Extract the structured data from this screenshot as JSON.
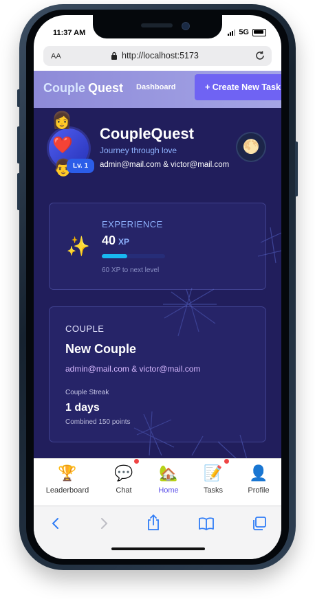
{
  "status": {
    "time": "11:37 AM",
    "network": "5G"
  },
  "browser": {
    "text_size": "AA",
    "url": "http://localhost:5173"
  },
  "header": {
    "brand_part1": "Couple",
    "brand_part2": "Quest",
    "nav_dashboard": "Dashboard",
    "create_button": "+ Create New Task"
  },
  "profile": {
    "title": "CoupleQuest",
    "tagline": "Journey through love",
    "emails": "admin@mail.com & victor@mail.com",
    "level": "Lv. 1",
    "emoji_top": "👩",
    "emoji_heart": "❤️",
    "emoji_bottom": "👨",
    "theme_icon": "🌕"
  },
  "experience": {
    "label": "EXPERIENCE",
    "value": "40",
    "unit": "XP",
    "progress_fraction": 0.4,
    "next_level": "60 XP to next level",
    "icon": "✨"
  },
  "couple": {
    "label": "COUPLE",
    "name": "New Couple",
    "emails": "admin@mail.com & victor@mail.com",
    "streak_label": "Couple Streak",
    "streak_value": "1 days",
    "points": "Combined 150 points"
  },
  "tabs": [
    {
      "label": "Leaderboard",
      "icon": "🏆"
    },
    {
      "label": "Chat",
      "icon": "💬"
    },
    {
      "label": "Home",
      "icon": "🏡"
    },
    {
      "label": "Tasks",
      "icon": "📝"
    },
    {
      "label": "Profile",
      "icon": "👤"
    }
  ],
  "colors": {
    "accent": "#6f63f3",
    "background": "#211e5c",
    "progress": "#18b8f0",
    "active_tab": "#5a4ee8",
    "notification": "#ef4444"
  }
}
